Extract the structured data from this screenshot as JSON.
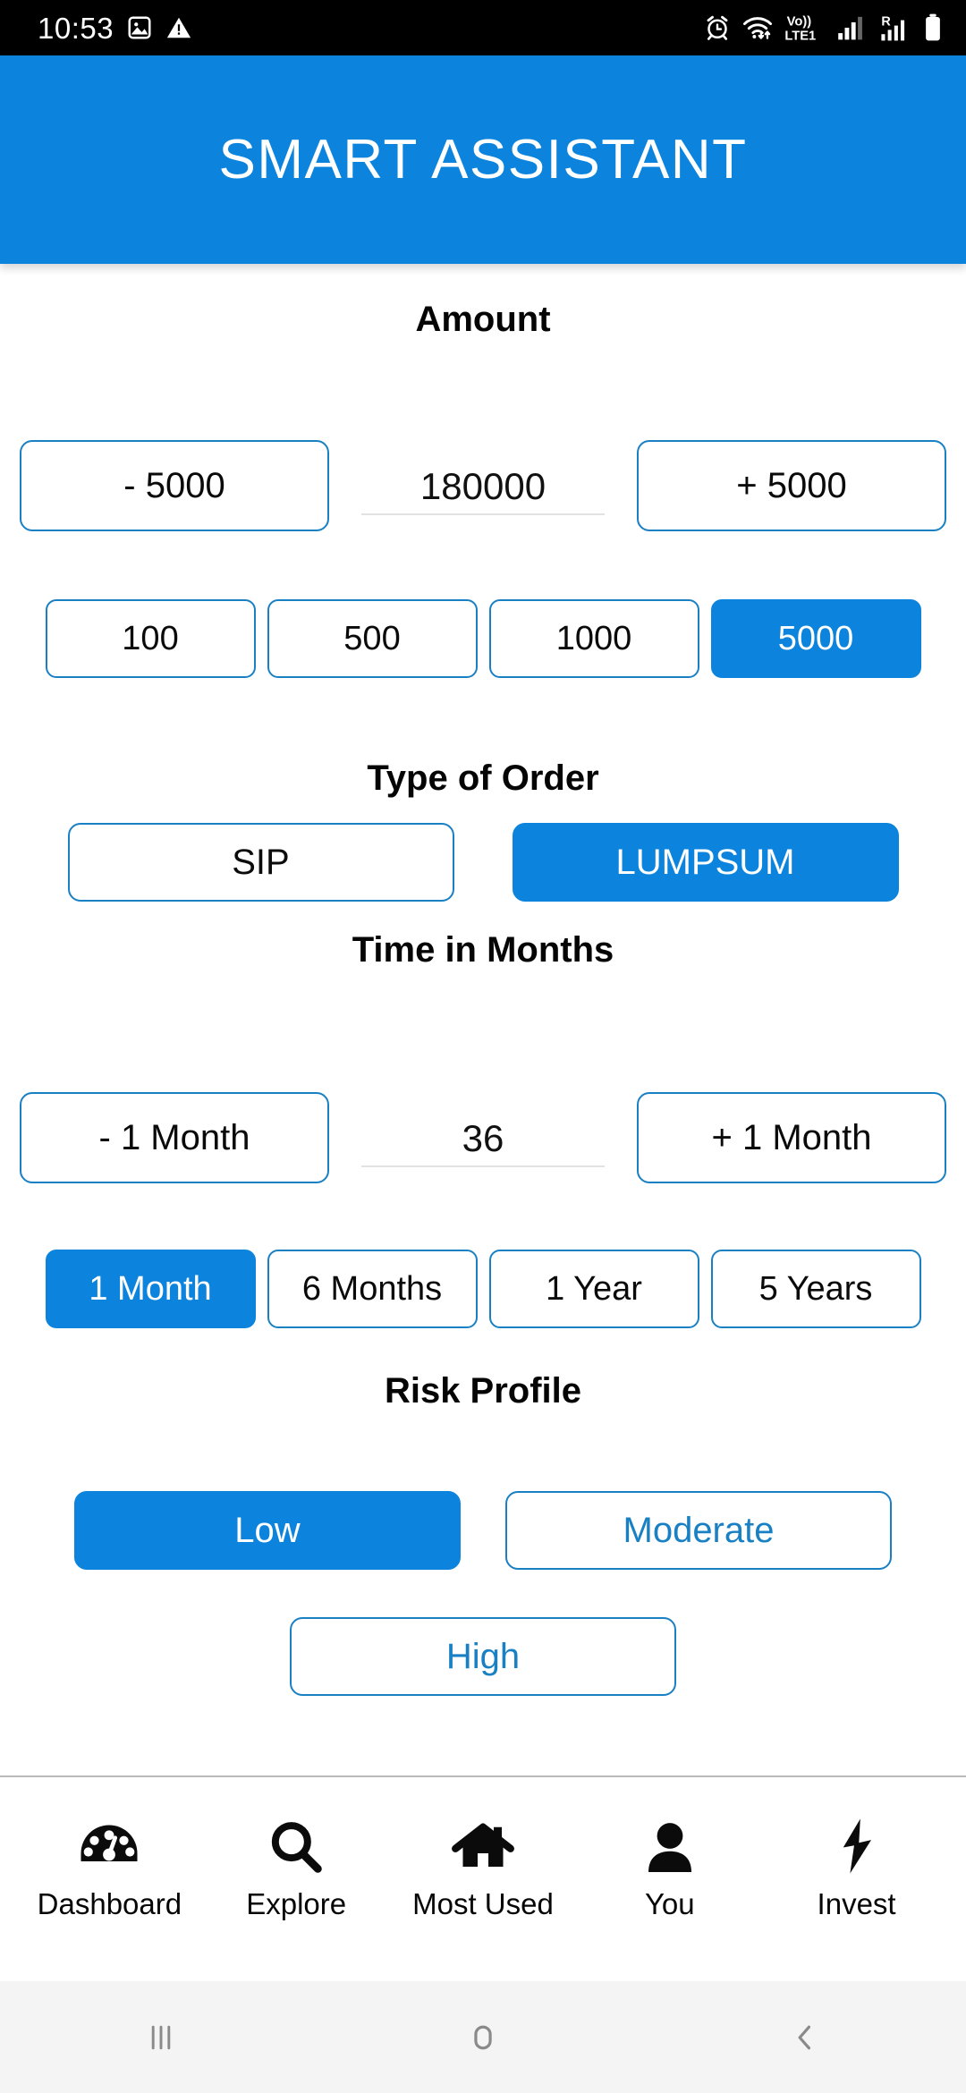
{
  "status_bar": {
    "time": "10:53",
    "left_icons": [
      "image-icon",
      "warning-icon"
    ],
    "right_icons": [
      "alarm-icon",
      "wifi-icon",
      "volte1-icon",
      "signal-icon",
      "roaming-signal-icon",
      "battery-icon"
    ],
    "volte_label": "Vo))",
    "lte_label": "LTE1",
    "roaming_label": "R"
  },
  "app_bar": {
    "title": "SMART ASSISTANT",
    "background": "#0c84dd"
  },
  "amount": {
    "title": "Amount",
    "decrement_label": "- 5000",
    "increment_label": "+ 5000",
    "value": "180000",
    "chips": [
      {
        "label": "100",
        "selected": false
      },
      {
        "label": "500",
        "selected": false
      },
      {
        "label": "1000",
        "selected": false
      },
      {
        "label": "5000",
        "selected": true
      }
    ]
  },
  "order_type": {
    "title": "Type of Order",
    "options": [
      {
        "label": "SIP",
        "selected": false
      },
      {
        "label": "LUMPSUM",
        "selected": true
      }
    ]
  },
  "time_in_months": {
    "title": "Time in Months",
    "decrement_label": "- 1 Month",
    "increment_label": "+ 1 Month",
    "value": "36",
    "chips": [
      {
        "label": "1 Month",
        "selected": true
      },
      {
        "label": "6 Months",
        "selected": false
      },
      {
        "label": "1 Year",
        "selected": false
      },
      {
        "label": "5 Years",
        "selected": false
      }
    ]
  },
  "risk_profile": {
    "title": "Risk Profile",
    "options": [
      {
        "label": "Low",
        "selected": true
      },
      {
        "label": "Moderate",
        "selected": false
      },
      {
        "label": "High",
        "selected": false
      }
    ]
  },
  "bottom_nav": {
    "items": [
      {
        "label": "Dashboard",
        "icon": "speedometer-icon"
      },
      {
        "label": "Explore",
        "icon": "search-icon"
      },
      {
        "label": "Most Used",
        "icon": "home-icon"
      },
      {
        "label": "You",
        "icon": "person-icon"
      },
      {
        "label": "Invest",
        "icon": "lightning-bolt-icon"
      }
    ]
  },
  "system_nav": {
    "items": [
      {
        "name": "recents-button"
      },
      {
        "name": "home-button"
      },
      {
        "name": "back-button"
      }
    ]
  },
  "colors": {
    "accent": "#0c84dd",
    "border": "#1a80c4",
    "text": "#0a0a0a"
  }
}
